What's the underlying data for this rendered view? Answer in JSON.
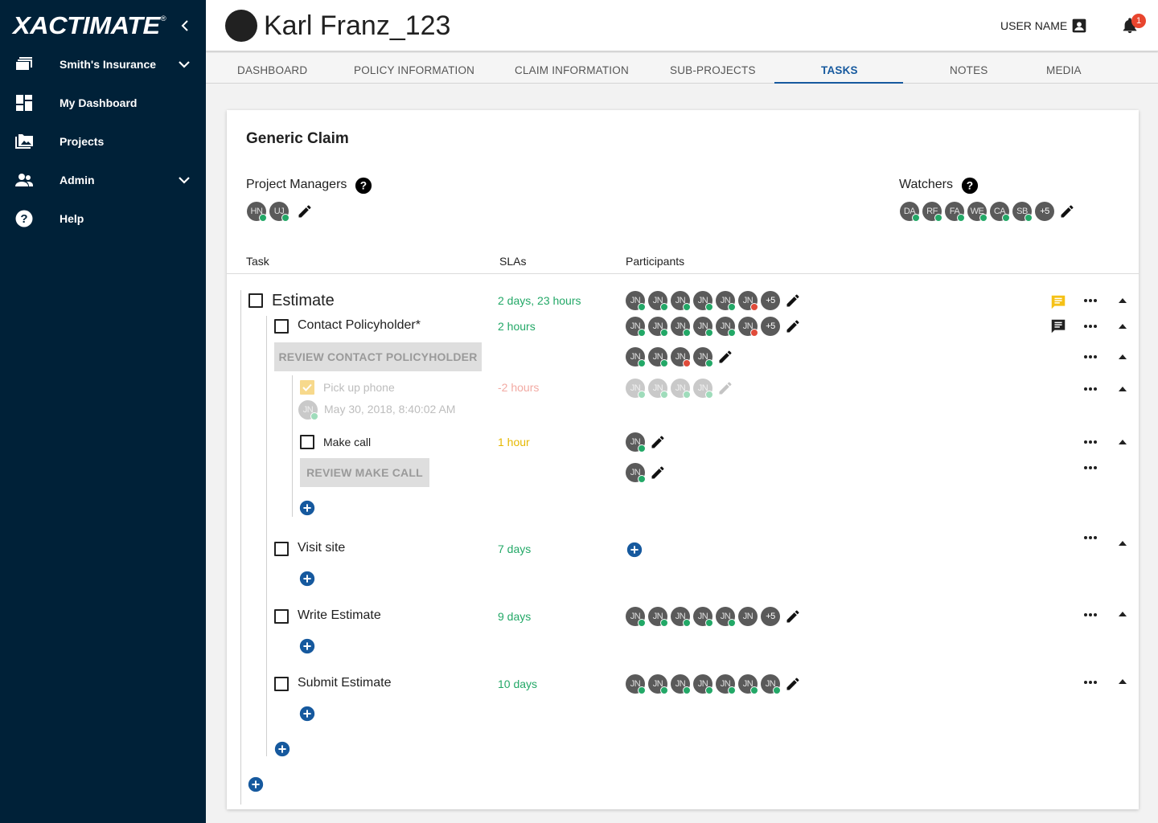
{
  "app": {
    "logo": "XACTIMATE",
    "logo_mark": "®"
  },
  "sidebar": {
    "items": [
      {
        "label": "Smith's Insurance",
        "icon": "insurance-cards-icon",
        "expandable": true
      },
      {
        "label": "My Dashboard",
        "icon": "dashboard-icon",
        "expandable": false
      },
      {
        "label": "Projects",
        "icon": "projects-icon",
        "expandable": false
      },
      {
        "label": "Admin",
        "icon": "admin-people-icon",
        "expandable": true
      },
      {
        "label": "Help",
        "icon": "help-icon",
        "expandable": false
      }
    ]
  },
  "header": {
    "title": "Karl Franz_123",
    "user_name": "USER NAME",
    "notification_count": "1"
  },
  "tabs": [
    {
      "label": "DASHBOARD",
      "active": false
    },
    {
      "label": "POLICY INFORMATION",
      "active": false
    },
    {
      "label": "CLAIM INFORMATION",
      "active": false
    },
    {
      "label": "SUB-PROJECTS",
      "active": false
    },
    {
      "label": "TASKS",
      "active": true
    },
    {
      "label": "NOTES",
      "active": false
    },
    {
      "label": "MEDIA",
      "active": false
    }
  ],
  "claim": {
    "title": "Generic Claim",
    "project_managers_label": "Project Managers",
    "project_managers": [
      {
        "initials": "HN",
        "status": "ok"
      },
      {
        "initials": "UJ",
        "status": "ok"
      }
    ],
    "watchers_label": "Watchers",
    "watchers": [
      {
        "initials": "DA",
        "status": "ok"
      },
      {
        "initials": "RF",
        "status": "ok"
      },
      {
        "initials": "FA",
        "status": "ok"
      },
      {
        "initials": "WE",
        "status": "ok"
      },
      {
        "initials": "CA",
        "status": "ok"
      },
      {
        "initials": "SB",
        "status": "ok"
      }
    ],
    "watchers_more": "+5"
  },
  "columns": {
    "task": "Task",
    "slas": "SLAs",
    "participants": "Participants"
  },
  "tasks": {
    "estimate": {
      "label": "Estimate",
      "sla": "2 days, 23 hours",
      "more": "+5"
    },
    "contact": {
      "label": "Contact Policyholder*",
      "sla": "2 hours",
      "more": "+5"
    },
    "review_contact": {
      "label": "REVIEW CONTACT POLICYHOLDER"
    },
    "pickup": {
      "label": "Pick up phone",
      "sla": "-2 hours",
      "completed_by": "JN",
      "completed_at": "May 30, 2018, 8:40:02 AM"
    },
    "make_call": {
      "label": "Make call",
      "sla": "1 hour"
    },
    "review_make_call": {
      "label": "REVIEW MAKE CALL"
    },
    "visit_site": {
      "label": "Visit site",
      "sla": "7 days"
    },
    "write_estimate": {
      "label": "Write Estimate",
      "sla": "9 days",
      "more": "+5"
    },
    "submit_estimate": {
      "label": "Submit Estimate",
      "sla": "10 days"
    }
  },
  "participant_initials": "JN",
  "colors": {
    "sidebar_bg": "#002138",
    "accent_blue": "#16599e",
    "sla_green": "#23a867",
    "sla_amber": "#e6b800",
    "status_ok": "#23a867",
    "status_rejected": "#e04b3a",
    "comment_yellow": "#f5c116",
    "badge_red": "#e8452e"
  }
}
